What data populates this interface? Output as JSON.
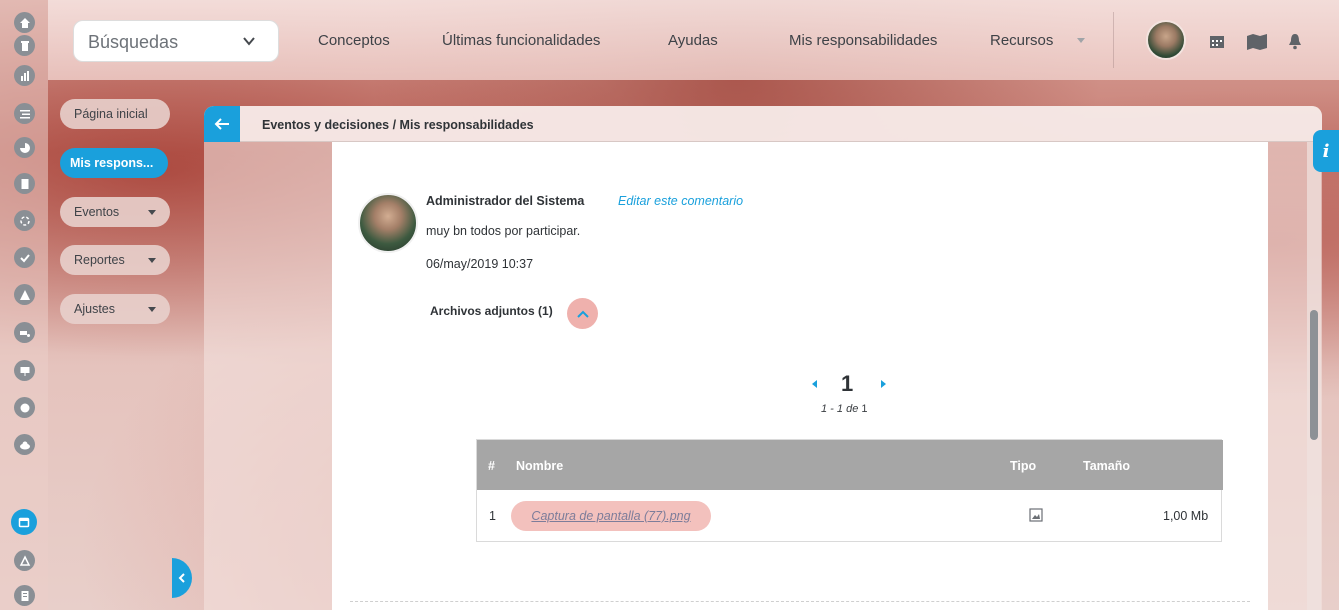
{
  "topbar": {
    "search_label": "Búsquedas",
    "nav": [
      {
        "label": "Conceptos"
      },
      {
        "label": "Últimas funcionalidades"
      },
      {
        "label": "Ayudas"
      },
      {
        "label": "Mis responsabilidades"
      },
      {
        "label": "Recursos"
      }
    ]
  },
  "sidebar": {
    "items": [
      {
        "label": "Página inicial"
      },
      {
        "label": "Mis respons..."
      },
      {
        "label": "Eventos"
      },
      {
        "label": "Reportes"
      },
      {
        "label": "Ajustes"
      }
    ]
  },
  "panel": {
    "breadcrumb": "Eventos y decisiones / Mis responsabilidades"
  },
  "comment": {
    "author": "Administrador del Sistema",
    "edit_link": "Editar este comentario",
    "text": "muy bn todos por participar.",
    "date": "06/may/2019 10:37",
    "attachments_label": "Archivos adjuntos (1)"
  },
  "pager": {
    "current_page": "1",
    "range": "1 - 1",
    "de": "de",
    "total": "1"
  },
  "files_table": {
    "columns": [
      "#",
      "Nombre",
      "Tipo",
      "Tamaño"
    ],
    "rows": [
      {
        "index": "1",
        "name": "Captura de pantalla (77).png",
        "type_icon": "image-file-icon",
        "size": "1,00 Mb"
      }
    ]
  },
  "colors": {
    "accent": "#1aa0dc",
    "table_header": "#a6a6a6",
    "highlight": "#f3c1bd"
  },
  "info_button": "i"
}
